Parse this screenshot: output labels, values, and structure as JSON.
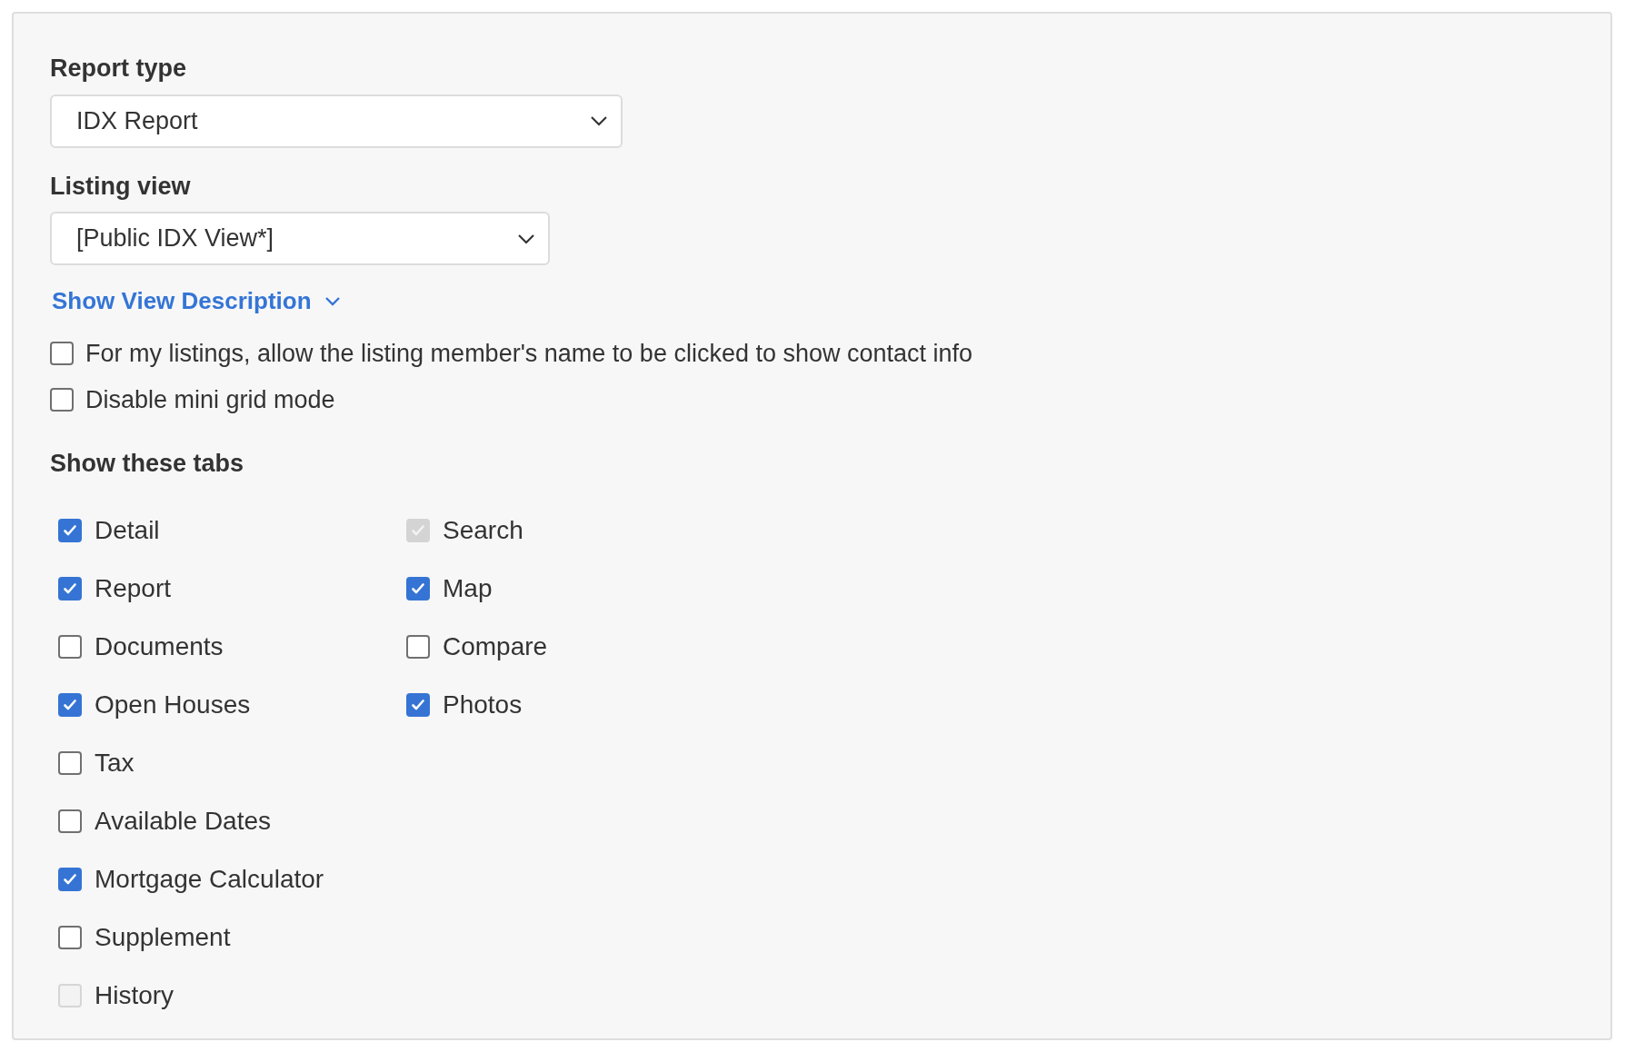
{
  "report_type": {
    "label": "Report type",
    "value": "IDX Report"
  },
  "listing_view": {
    "label": "Listing view",
    "value": "[Public IDX View*]"
  },
  "description_link": {
    "label": "Show View Description",
    "expanded": false
  },
  "options": [
    {
      "label": "For my listings, allow the listing member's name to be clicked to show contact info",
      "checked": false
    },
    {
      "label": "Disable mini grid mode",
      "checked": false
    }
  ],
  "tabs_section": {
    "title": "Show these tabs",
    "columns": [
      [
        {
          "label": "Detail",
          "checked": true,
          "disabled": false
        },
        {
          "label": "Report",
          "checked": true,
          "disabled": false
        },
        {
          "label": "Documents",
          "checked": false,
          "disabled": false
        },
        {
          "label": "Open Houses",
          "checked": true,
          "disabled": false
        },
        {
          "label": "Tax",
          "checked": false,
          "disabled": false
        },
        {
          "label": "Available Dates",
          "checked": false,
          "disabled": false
        },
        {
          "label": "Mortgage Calculator",
          "checked": true,
          "disabled": false
        },
        {
          "label": "Supplement",
          "checked": false,
          "disabled": false
        },
        {
          "label": "History",
          "checked": false,
          "disabled": true
        }
      ],
      [
        {
          "label": "Search",
          "checked": true,
          "disabled": true
        },
        {
          "label": "Map",
          "checked": true,
          "disabled": false
        },
        {
          "label": "Compare",
          "checked": false,
          "disabled": false
        },
        {
          "label": "Photos",
          "checked": true,
          "disabled": false
        }
      ]
    ]
  }
}
